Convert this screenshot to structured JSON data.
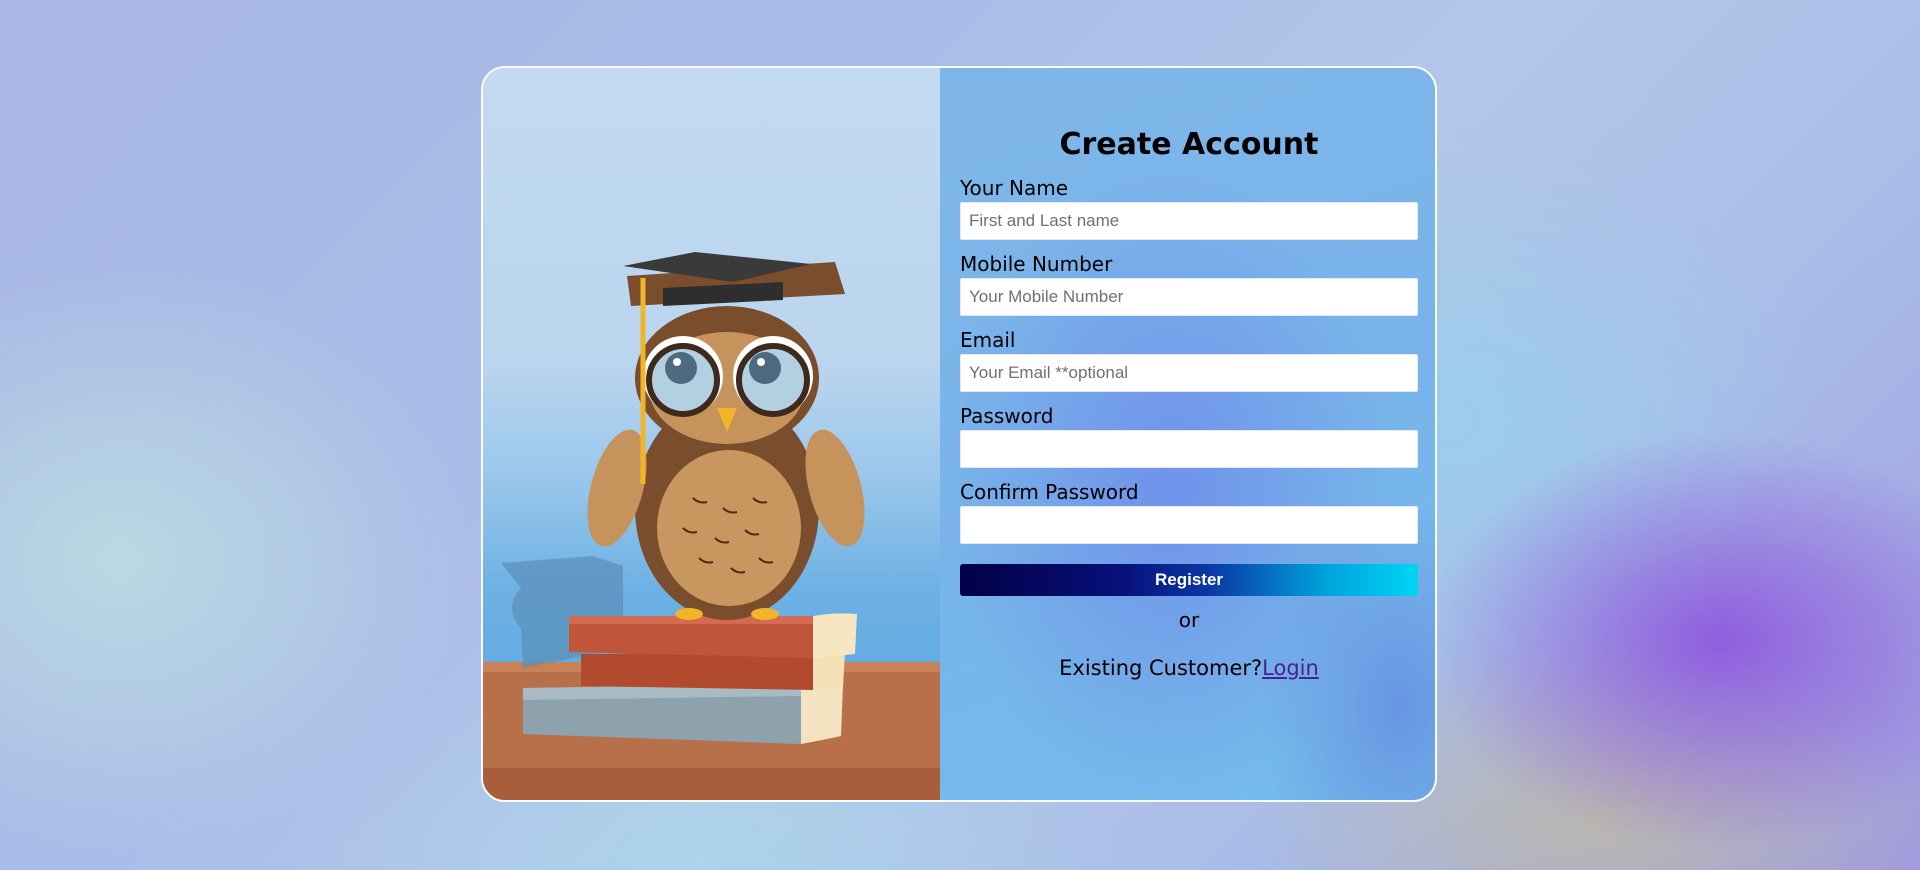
{
  "form": {
    "title": "Create Account",
    "fields": [
      {
        "label": "Your Name",
        "placeholder": "First and Last name",
        "value": ""
      },
      {
        "label": "Mobile Number",
        "placeholder": "Your Mobile Number",
        "value": ""
      },
      {
        "label": "Email",
        "placeholder": "Your Email **optional",
        "value": ""
      },
      {
        "label": "Password",
        "placeholder": "",
        "value": ""
      },
      {
        "label": "Confirm Password",
        "placeholder": "",
        "value": ""
      }
    ],
    "register_label": "Register",
    "or_text": "or",
    "existing_text": "Existing Customer?",
    "login_link": "Login"
  },
  "colors": {
    "register_gradient_start": "#020046",
    "register_gradient_end": "#00d4f5",
    "login_link": "#4b1f8f"
  },
  "illustration": {
    "subject": "owl-with-graduation-cap-on-books"
  }
}
